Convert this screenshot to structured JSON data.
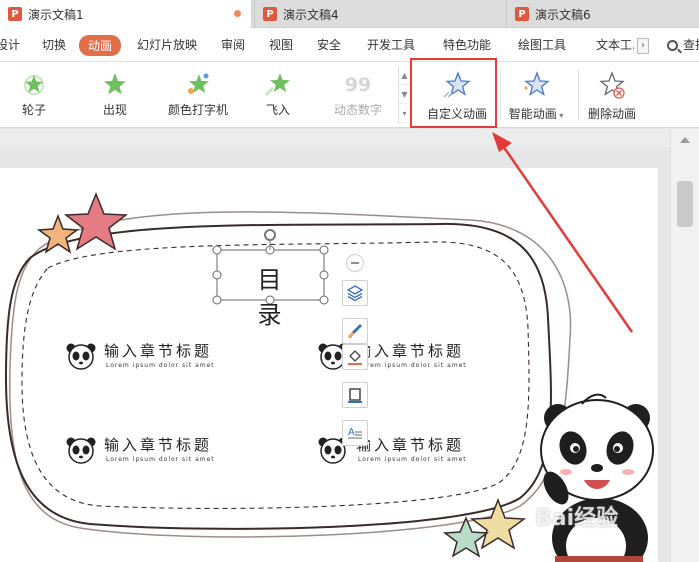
{
  "tabs": [
    {
      "label": "演示文稿1",
      "state": "active",
      "modified": true
    },
    {
      "label": "演示文稿4",
      "state": "inactive"
    },
    {
      "label": "演示文稿6",
      "state": "inactive"
    }
  ],
  "tab_icon_letter": "P",
  "menu": {
    "items": [
      "设计",
      "切换",
      "动画",
      "幻灯片放映",
      "审阅",
      "视图",
      "安全",
      "开发工具",
      "特色功能",
      "绘图工具",
      "文本工..."
    ],
    "active": "动画",
    "search_label": "查找"
  },
  "ribbon": {
    "gallery": [
      {
        "label": "轮子",
        "icon": "wheel-star-icon",
        "enabled": true
      },
      {
        "label": "出现",
        "icon": "appear-star-icon",
        "enabled": true
      },
      {
        "label": "颜色打字机",
        "icon": "typewriter-star-icon",
        "enabled": true
      },
      {
        "label": "飞入",
        "icon": "fly-in-star-icon",
        "enabled": true
      },
      {
        "label": "动态数字",
        "icon": "dynamic-number-icon",
        "enabled": false,
        "icon_text": "99"
      }
    ],
    "custom_animation": {
      "label": "自定义动画",
      "icon": "custom-animation-star-icon"
    },
    "smart_animation": {
      "label": "智能动画",
      "icon": "smart-animation-star-icon"
    },
    "delete_animation": {
      "label": "删除动画",
      "icon": "delete-animation-star-icon"
    }
  },
  "slide": {
    "title": "目录",
    "entries": [
      {
        "heading": "输入章节标题",
        "sub": "Lorem ipsum dolor sit amet"
      },
      {
        "heading": "输入章节标题",
        "sub": "Lorem ipsum dolor sit amet"
      },
      {
        "heading": "输入章节标题",
        "sub": "Lorem ipsum dolor sit amet"
      },
      {
        "heading": "输入章节标题",
        "sub": "Lorem ipsum dolor sit amet"
      }
    ],
    "float_tools": [
      "collapse-icon",
      "layers-icon",
      "paint-brush-icon",
      "fill-bucket-icon",
      "border-icon",
      "text-format-icon"
    ]
  },
  "watermark": "Bai经验",
  "colors": {
    "accent": "#e0704a",
    "highlight_box": "#e43a3a",
    "arrow": "#e43a3a",
    "tab_icon": "#e0593e",
    "star_pink": "#e57c84",
    "star_orange": "#f3b37e",
    "star_yellow": "#efdca0",
    "star_mint": "#b7dcc8",
    "frame_line": "#4a3a3a"
  }
}
